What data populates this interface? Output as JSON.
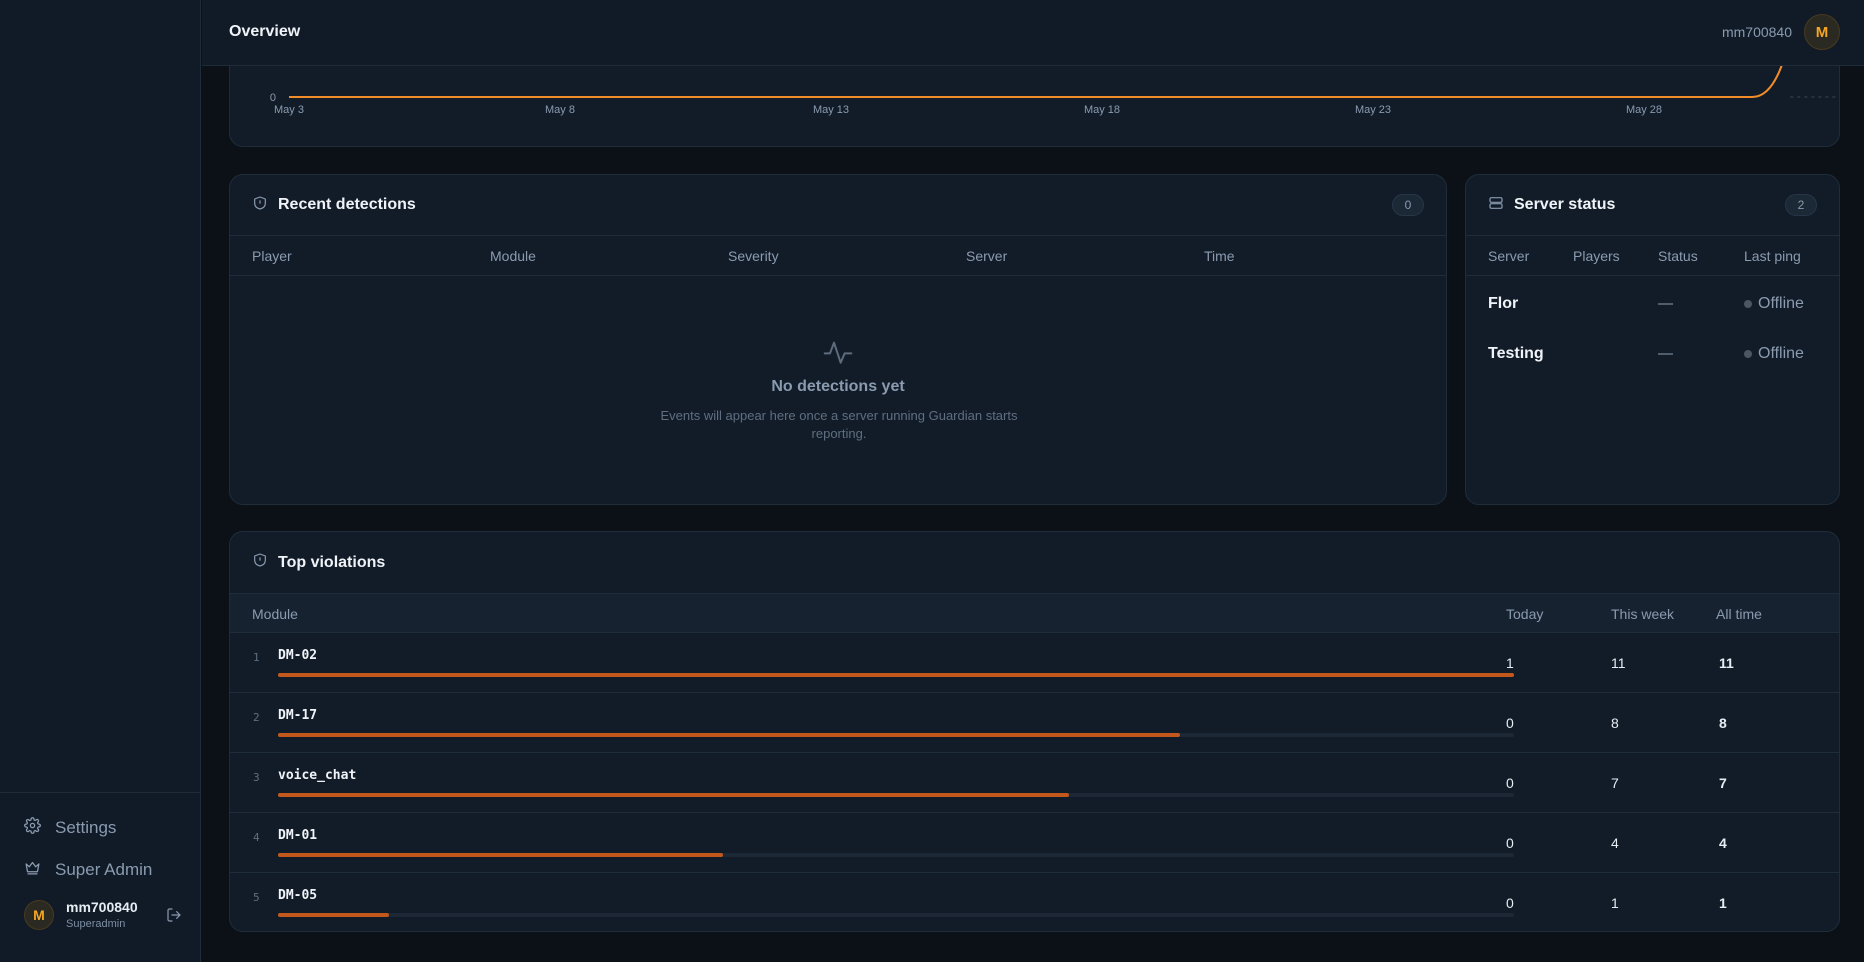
{
  "header": {
    "title": "Overview",
    "username": "mm700840",
    "avatar_letter": "M"
  },
  "sidebar": {
    "settings_label": "Settings",
    "superadmin_label": "Super Admin",
    "user": {
      "name": "mm700840",
      "role": "Superadmin",
      "avatar_letter": "M"
    }
  },
  "chart_data": {
    "type": "line",
    "x": [
      "May 3",
      "May 4",
      "May 5",
      "May 6",
      "May 7",
      "May 8",
      "May 9",
      "May 10",
      "May 11",
      "May 12",
      "May 13",
      "May 14",
      "May 15",
      "May 16",
      "May 17",
      "May 18",
      "May 19",
      "May 20",
      "May 21",
      "May 22",
      "May 23",
      "May 24",
      "May 25",
      "May 26",
      "May 27",
      "May 28",
      "May 29",
      "May 30",
      "May 31",
      "Jun 1"
    ],
    "x_tick_labels": [
      "May 3",
      "May 8",
      "May 13",
      "May 18",
      "May 23",
      "May 28"
    ],
    "y_tick_labels": [
      "0"
    ],
    "series": [
      {
        "values": [
          0,
          0,
          0,
          0,
          0,
          0,
          0,
          0,
          0,
          0,
          0,
          0,
          0,
          0,
          0,
          0,
          0,
          0,
          0,
          0,
          0,
          0,
          0,
          0,
          0,
          0,
          0,
          0,
          1,
          0
        ]
      }
    ],
    "colors": {
      "line": "#f28c28"
    }
  },
  "recent_detections": {
    "title": "Recent detections",
    "count": "0",
    "columns": [
      "Player",
      "Module",
      "Severity",
      "Server",
      "Time"
    ],
    "empty_title": "No detections yet",
    "empty_desc": "Events will appear here once a server running Guardian starts reporting."
  },
  "server_status": {
    "title": "Server status",
    "count": "2",
    "columns": [
      "Server",
      "Players",
      "Status",
      "Last ping"
    ],
    "rows": [
      {
        "name": "Flor",
        "status": "—",
        "last_ping": "Offline"
      },
      {
        "name": "Testing",
        "status": "—",
        "last_ping": "Offline"
      }
    ]
  },
  "top_violations": {
    "title": "Top violations",
    "columns": [
      "Module",
      "Today",
      "This week",
      "All time"
    ],
    "rows": [
      {
        "rank": "1",
        "module": "DM-02",
        "today": "1",
        "week": "11",
        "all": "11",
        "share": 1.0
      },
      {
        "rank": "2",
        "module": "DM-17",
        "today": "0",
        "week": "8",
        "all": "8",
        "share": 0.73
      },
      {
        "rank": "3",
        "module": "voice_chat",
        "today": "0",
        "week": "7",
        "all": "7",
        "share": 0.64
      },
      {
        "rank": "4",
        "module": "DM-01",
        "today": "0",
        "week": "4",
        "all": "4",
        "share": 0.36
      },
      {
        "rank": "5",
        "module": "DM-05",
        "today": "0",
        "week": "1",
        "all": "1",
        "share": 0.09
      }
    ],
    "bar_color": "#c2581c"
  }
}
